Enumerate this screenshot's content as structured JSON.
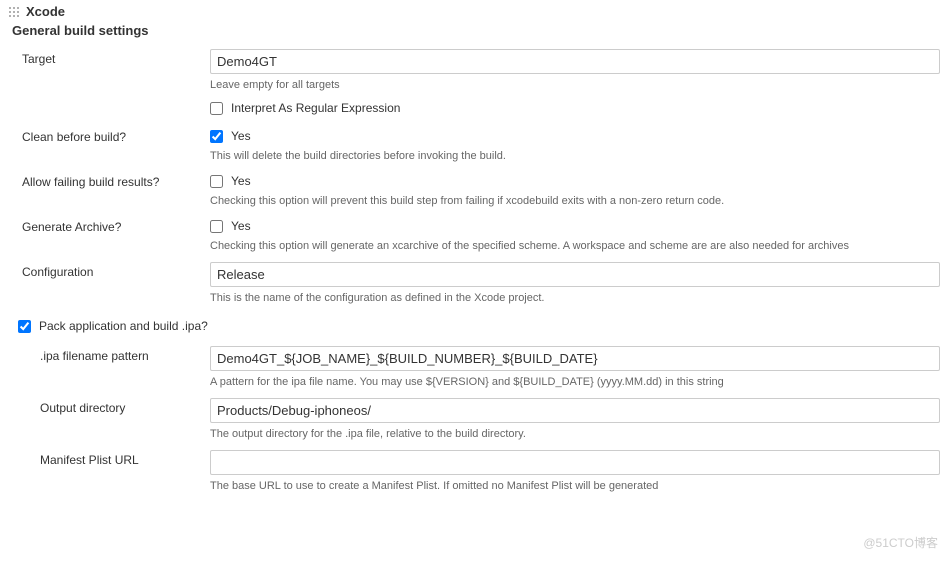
{
  "header": {
    "title": "Xcode"
  },
  "section_general": {
    "title": "General build settings"
  },
  "fields": {
    "target": {
      "label": "Target",
      "value": "Demo4GT",
      "help": "Leave empty for all targets",
      "regex_checkbox": {
        "checked": false,
        "label": "Interpret As Regular Expression"
      }
    },
    "clean_before_build": {
      "label": "Clean before build?",
      "checked": true,
      "yes": "Yes",
      "help": "This will delete the build directories before invoking the build."
    },
    "allow_failing": {
      "label": "Allow failing build results?",
      "checked": false,
      "yes": "Yes",
      "help": "Checking this option will prevent this build step from failing if xcodebuild exits with a non-zero return code."
    },
    "generate_archive": {
      "label": "Generate Archive?",
      "checked": false,
      "yes": "Yes",
      "help": "Checking this option will generate an xcarchive of the specified scheme. A workspace and scheme are are also needed for archives"
    },
    "configuration": {
      "label": "Configuration",
      "value": "Release",
      "help": "This is the name of the configuration as defined in the Xcode project."
    }
  },
  "pack_section": {
    "checked": true,
    "label": "Pack application and build .ipa?",
    "ipa_filename": {
      "label": ".ipa filename pattern",
      "value": "Demo4GT_${JOB_NAME}_${BUILD_NUMBER}_${BUILD_DATE}",
      "help": "A pattern for the ipa file name. You may use ${VERSION} and ${BUILD_DATE} (yyyy.MM.dd) in this string"
    },
    "output_dir": {
      "label": "Output directory",
      "value": "Products/Debug-iphoneos/",
      "help": "The output directory for the .ipa file, relative to the build directory."
    },
    "manifest_plist": {
      "label": "Manifest Plist URL",
      "value": "",
      "help": "The base URL to use to create a Manifest Plist. If omitted no Manifest Plist will be generated"
    }
  },
  "watermark": "@51CTO博客"
}
